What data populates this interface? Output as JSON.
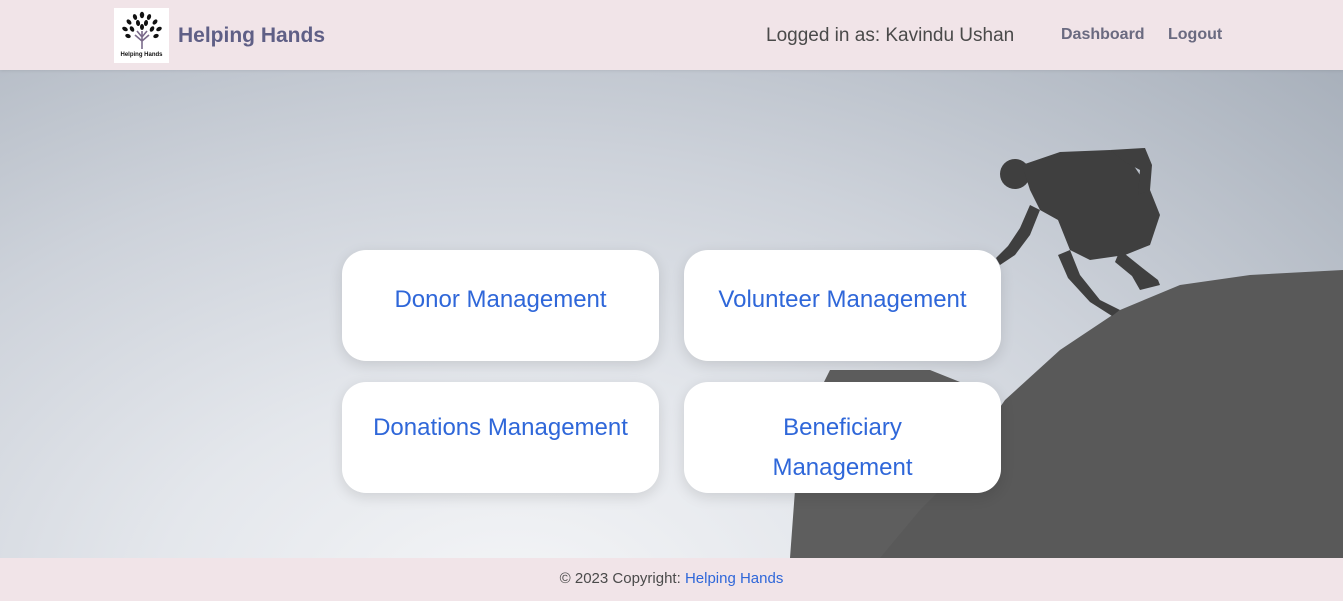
{
  "navbar": {
    "brand_name": "Helping Hands",
    "logo_text": "Helping Hands",
    "user_label": "Logged in as: Kavindu Ushan",
    "links": {
      "dashboard": "Dashboard",
      "logout": "Logout"
    }
  },
  "cards": [
    {
      "title": "Donor Management"
    },
    {
      "title": "Volunteer Management"
    },
    {
      "title": "Donations Management"
    },
    {
      "title": "Beneficiary Management"
    }
  ],
  "footer": {
    "copyright_text": "© 2023 Copyright: ",
    "link_text": "Helping Hands"
  },
  "colors": {
    "header_bg": "#f1e4e8",
    "brand": "#5f5f86",
    "card_text": "#2f67d9",
    "footer_link": "#2f67d9"
  }
}
